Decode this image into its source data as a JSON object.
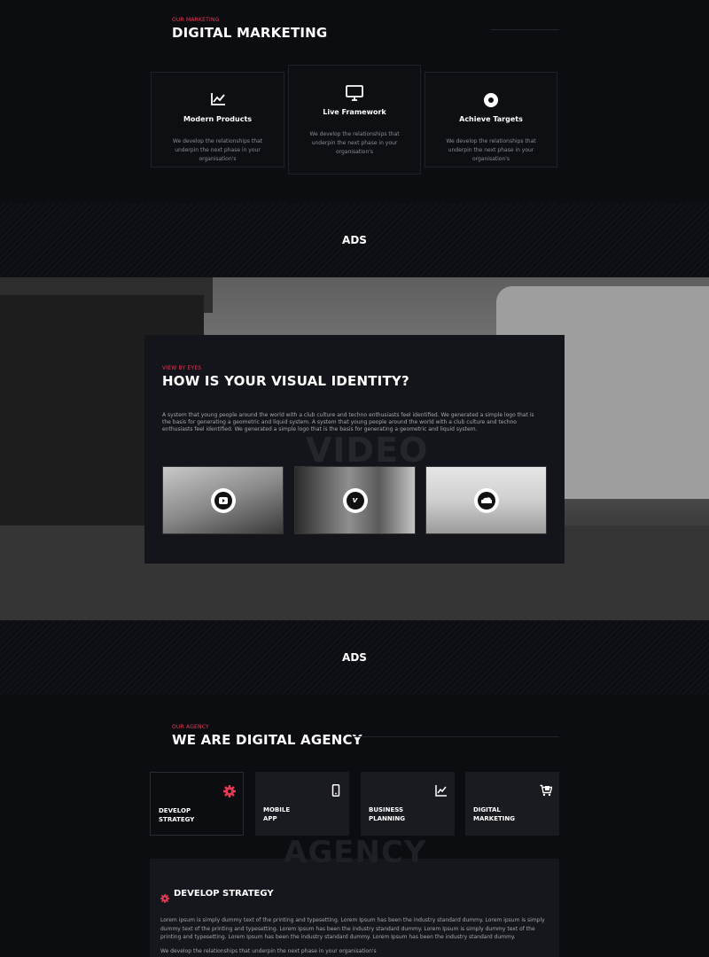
{
  "marketing": {
    "eyebrow": "OUR MARKETING",
    "title": "DIGITAL MARKETING",
    "cards": [
      {
        "icon": "chart-line-icon",
        "title": "Modern Products",
        "desc": "We develop the relationships that underpin the next phase in your organisation's"
      },
      {
        "icon": "monitor-icon",
        "title": "Live Framework",
        "desc": "We develop the relationships that underpin the next phase in your organisation's"
      },
      {
        "icon": "target-icon",
        "title": "Achieve Targets",
        "desc": "We develop the relationships that underpin the next phase in your organisation's"
      }
    ]
  },
  "ads_label": "ADS",
  "visual": {
    "eyebrow": "VIEW BY EYES",
    "title": "HOW IS YOUR VISUAL IDENTITY?",
    "body": "A system that young people around the world with a club culture and techno enthusiasts feel identified. We generated a simple logo that is the basis for generating a geometric and liquid system. A system that young people around the world with a club culture and techno enthusiasts feel identified. We generated a simple logo that is the basis for generating a geometric and liquid system.",
    "watermark": "VIDEO",
    "videos": [
      {
        "icon": "youtube-icon"
      },
      {
        "icon": "vimeo-icon"
      },
      {
        "icon": "soundcloud-icon"
      }
    ]
  },
  "agency": {
    "eyebrow": "OUR AGENCY",
    "title": "WE ARE DIGITAL AGENCY",
    "watermark": "AGENCY",
    "accent": "#e63a55",
    "tiles": [
      {
        "icon": "gear-icon",
        "line1": "DEVELOP",
        "line2": "STRATEGY",
        "active": true
      },
      {
        "icon": "smartphone-icon",
        "line1": "MOBILE",
        "line2": "APP",
        "active": false
      },
      {
        "icon": "chart-line-icon",
        "line1": "BUSINESS",
        "line2": "PLANNING",
        "active": false
      },
      {
        "icon": "cart-icon",
        "line1": "DIGITAL",
        "line2": "MARKETING",
        "active": false
      }
    ],
    "detail": {
      "title": "DEVELOP STRATEGY",
      "body": "Lorem ipsum is simply dummy text of the printing and typesetting. Lorem Ipsum has been the industry standard dummy. Lorem ipsum is simply dummy text of the printing and typesetting. Lorem Ipsum has been the industry standard dummy. Lorem Ipsum is simply dummy text of the printing and typesetting. Lorem Ipsum has been the industry standard dummy. Lorem Ipsum has been the industry standard dummy.",
      "footer": "We develop the relationships that underpin the next phase in your organisation's"
    }
  }
}
